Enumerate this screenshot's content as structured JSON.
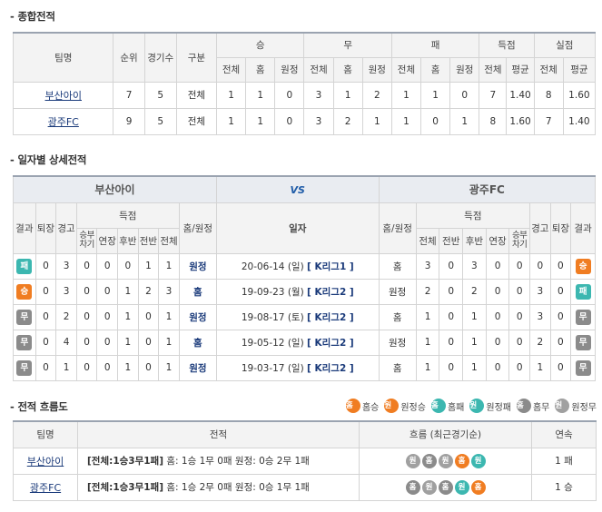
{
  "overall": {
    "title": "종합전적",
    "headers": {
      "team": "팀명",
      "rank": "순위",
      "games": "경기수",
      "type": "구분",
      "win": "승",
      "draw": "무",
      "lose": "패",
      "goals": "득점",
      "conceded": "실점",
      "total": "전체",
      "home": "홈",
      "away": "원정",
      "avg": "평균"
    },
    "rows": [
      {
        "team": "부산아이",
        "rank": "7",
        "games": "5",
        "type": "전체",
        "cells": [
          "1",
          "1",
          "0",
          "3",
          "1",
          "2",
          "1",
          "1",
          "0",
          "7",
          "1.40",
          "8",
          "1.60"
        ]
      },
      {
        "team": "광주FC",
        "rank": "9",
        "games": "5",
        "type": "전체",
        "cells": [
          "1",
          "1",
          "0",
          "3",
          "2",
          "1",
          "1",
          "0",
          "1",
          "8",
          "1.60",
          "7",
          "1.40"
        ]
      }
    ]
  },
  "detail": {
    "title": "일자별 상세전적",
    "team_left": "부산아이",
    "vs": "VS",
    "team_right": "광주FC",
    "headers": {
      "result": "결과",
      "sentoff": "퇴장",
      "warning": "경고",
      "goals": "득점",
      "pk": "승부차기",
      "extra": "연장",
      "second": "후반",
      "first": "전반",
      "total": "전체",
      "venue": "홈/원정",
      "date": "일자"
    },
    "rows": [
      {
        "l_result": "패",
        "l_cls": "b-lose",
        "l_sent": "0",
        "l_warn": "3",
        "l_pk": "0",
        "l_ext": "0",
        "l_2h": "0",
        "l_1h": "1",
        "l_tot": "1",
        "l_venue": "원정",
        "date": "20-06-14 (일)",
        "league": "[ K리그1 ]",
        "r_venue": "홈",
        "r_tot": "3",
        "r_1h": "0",
        "r_2h": "3",
        "r_ext": "0",
        "r_pk": "0",
        "r_warn": "0",
        "r_sent": "0",
        "r_result": "승",
        "r_cls": "b-win"
      },
      {
        "l_result": "승",
        "l_cls": "b-win",
        "l_sent": "0",
        "l_warn": "3",
        "l_pk": "0",
        "l_ext": "0",
        "l_2h": "1",
        "l_1h": "2",
        "l_tot": "3",
        "l_venue": "홈",
        "date": "19-09-23 (월)",
        "league": "[ K리그2 ]",
        "r_venue": "원정",
        "r_tot": "2",
        "r_1h": "0",
        "r_2h": "2",
        "r_ext": "0",
        "r_pk": "0",
        "r_warn": "3",
        "r_sent": "0",
        "r_result": "패",
        "r_cls": "b-lose"
      },
      {
        "l_result": "무",
        "l_cls": "b-draw",
        "l_sent": "0",
        "l_warn": "2",
        "l_pk": "0",
        "l_ext": "0",
        "l_2h": "1",
        "l_1h": "0",
        "l_tot": "1",
        "l_venue": "원정",
        "date": "19-08-17 (토)",
        "league": "[ K리그2 ]",
        "r_venue": "홈",
        "r_tot": "1",
        "r_1h": "0",
        "r_2h": "1",
        "r_ext": "0",
        "r_pk": "0",
        "r_warn": "3",
        "r_sent": "0",
        "r_result": "무",
        "r_cls": "b-draw"
      },
      {
        "l_result": "무",
        "l_cls": "b-draw",
        "l_sent": "0",
        "l_warn": "4",
        "l_pk": "0",
        "l_ext": "0",
        "l_2h": "1",
        "l_1h": "0",
        "l_tot": "1",
        "l_venue": "홈",
        "date": "19-05-12 (일)",
        "league": "[ K리그2 ]",
        "r_venue": "원정",
        "r_tot": "1",
        "r_1h": "0",
        "r_2h": "1",
        "r_ext": "0",
        "r_pk": "0",
        "r_warn": "2",
        "r_sent": "0",
        "r_result": "무",
        "r_cls": "b-draw"
      },
      {
        "l_result": "무",
        "l_cls": "b-draw",
        "l_sent": "0",
        "l_warn": "1",
        "l_pk": "0",
        "l_ext": "0",
        "l_2h": "1",
        "l_1h": "0",
        "l_tot": "1",
        "l_venue": "원정",
        "date": "19-03-17 (일)",
        "league": "[ K리그2 ]",
        "r_venue": "홈",
        "r_tot": "1",
        "r_1h": "0",
        "r_2h": "1",
        "r_ext": "0",
        "r_pk": "0",
        "r_warn": "1",
        "r_sent": "0",
        "r_result": "무",
        "r_cls": "b-draw"
      }
    ]
  },
  "flow": {
    "title": "전적 흐름도",
    "legend": [
      {
        "glyph": "홈",
        "cls": "c-homewin",
        "label": "홈승"
      },
      {
        "glyph": "원",
        "cls": "c-awaywin",
        "label": "원정승"
      },
      {
        "glyph": "홈",
        "cls": "c-homelose",
        "label": "홈패"
      },
      {
        "glyph": "원",
        "cls": "c-awaylose",
        "label": "원정패"
      },
      {
        "glyph": "홈",
        "cls": "c-homedraw",
        "label": "홈무"
      },
      {
        "glyph": "원",
        "cls": "c-awaydraw",
        "label": "원정무"
      }
    ],
    "headers": {
      "team": "팀명",
      "record": "전적",
      "flow": "흐름 (최근경기순)",
      "streak": "연속"
    },
    "rows": [
      {
        "team": "부산아이",
        "summary": "[전체:1승3무1패]",
        "detail": " 홈: 1승 1무 0패 원정: 0승 2무 1패",
        "flow": [
          {
            "glyph": "원",
            "cls": "c-awaydraw"
          },
          {
            "glyph": "홈",
            "cls": "c-homedraw"
          },
          {
            "glyph": "원",
            "cls": "c-awaydraw"
          },
          {
            "glyph": "홈",
            "cls": "c-homewin"
          },
          {
            "glyph": "원",
            "cls": "c-awaylose"
          }
        ],
        "streak": "1 패"
      },
      {
        "team": "광주FC",
        "summary": "[전체:1승3무1패]",
        "detail": " 홈: 1승 2무 0패 원정: 0승 1무 1패",
        "flow": [
          {
            "glyph": "홈",
            "cls": "c-homedraw"
          },
          {
            "glyph": "원",
            "cls": "c-awaydraw"
          },
          {
            "glyph": "홈",
            "cls": "c-homedraw"
          },
          {
            "glyph": "원",
            "cls": "c-awaylose"
          },
          {
            "glyph": "홈",
            "cls": "c-homewin"
          }
        ],
        "streak": "1 승"
      }
    ]
  }
}
